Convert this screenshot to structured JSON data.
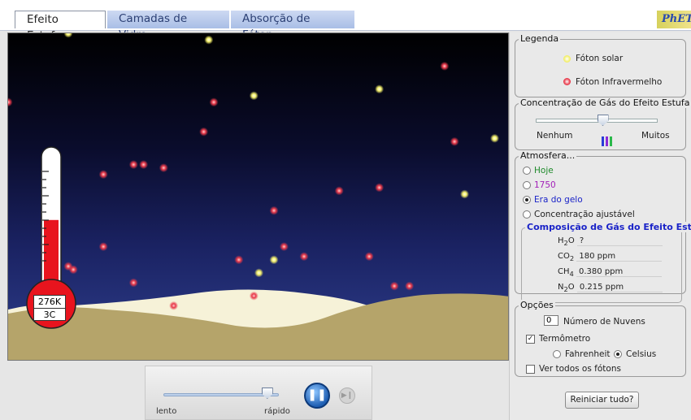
{
  "tabs": [
    {
      "label": "Efeito Estufa",
      "active": true
    },
    {
      "label": "Camadas de Vidro",
      "active": false
    },
    {
      "label": "Absorção de Fóton",
      "active": false
    }
  ],
  "logo_text": "PhET",
  "thermometer": {
    "kelvin": "276K",
    "celsius": "3C",
    "fill_fraction": 0.58
  },
  "speed": {
    "slow_label": "lento",
    "fast_label": "rápido",
    "value_fraction": 0.9
  },
  "playback": {
    "pause_icon": "pause-icon",
    "step_icon": "step-icon"
  },
  "legend": {
    "title": "Legenda",
    "items": [
      {
        "label": "Fóton solar",
        "color": "#f2ee6a"
      },
      {
        "label": "Fóton Infravermelho",
        "color": "#e8394a"
      }
    ]
  },
  "concentration": {
    "title": "Concentração de Gás do Efeito Estufa",
    "min_label": "Nenhum",
    "max_label": "Muitos",
    "value_fraction": 0.55,
    "bar_colors": [
      "#2a3bd8",
      "#8b2ad8",
      "#2ab84a"
    ]
  },
  "atmosphere": {
    "title": "Atmosfera...",
    "options": [
      {
        "label": "Hoje",
        "color": "#1e8a2a",
        "selected": false
      },
      {
        "label": "1750",
        "color": "#a21fb8",
        "selected": false
      },
      {
        "label": "Era do gelo",
        "color": "#1a23c8",
        "selected": true
      },
      {
        "label": "Concentração ajustável",
        "color": "#111111",
        "selected": false
      }
    ]
  },
  "composition": {
    "title": "Composição de Gás do Efeito Est...",
    "rows": [
      {
        "gas": "H",
        "sub": "2",
        "gas2": "O",
        "value": "?"
      },
      {
        "gas": "CO",
        "sub": "2",
        "gas2": "",
        "value": "180 ppm"
      },
      {
        "gas": "CH",
        "sub": "4",
        "gas2": "",
        "value": "0.380 ppm"
      },
      {
        "gas": "N",
        "sub": "2",
        "gas2": "O",
        "value": "0.215 ppm"
      }
    ]
  },
  "options": {
    "title": "Opções",
    "clouds_value": "0",
    "clouds_label": "Número de Nuvens",
    "thermometer_label": "Termômetro",
    "thermometer_checked": true,
    "fahrenheit_label": "Fahrenheit",
    "celsius_label": "Celsius",
    "celsius_selected": true,
    "all_photons_label": "Ver todos os fótons",
    "all_photons_checked": false
  },
  "reset_label": "Reiniciar tudo?",
  "photons": {
    "sunlight": [
      [
        0.4,
        0.02
      ],
      [
        0.49,
        0.19
      ],
      [
        0.74,
        0.17
      ],
      [
        0.97,
        0.32
      ],
      [
        0.91,
        0.49
      ],
      [
        0.53,
        0.69
      ],
      [
        0.5,
        0.73
      ],
      [
        0.12,
        0.0
      ]
    ],
    "infrared": [
      [
        0.87,
        0.1
      ],
      [
        0.41,
        0.21
      ],
      [
        0.39,
        0.3
      ],
      [
        0.89,
        0.33
      ],
      [
        0.27,
        0.4
      ],
      [
        0.31,
        0.41
      ],
      [
        0.19,
        0.43
      ],
      [
        0.25,
        0.4
      ],
      [
        0.66,
        0.48
      ],
      [
        0.74,
        0.47
      ],
      [
        0.53,
        0.54
      ],
      [
        0.19,
        0.65
      ],
      [
        0.46,
        0.69
      ],
      [
        0.55,
        0.65
      ],
      [
        0.59,
        0.68
      ],
      [
        0.72,
        0.68
      ],
      [
        0.12,
        0.71
      ],
      [
        0.13,
        0.72
      ],
      [
        0.25,
        0.76
      ],
      [
        0.77,
        0.77
      ],
      [
        0.8,
        0.77
      ],
      [
        0.33,
        0.83
      ],
      [
        0.49,
        0.8
      ],
      [
        0.0,
        0.21
      ]
    ]
  }
}
